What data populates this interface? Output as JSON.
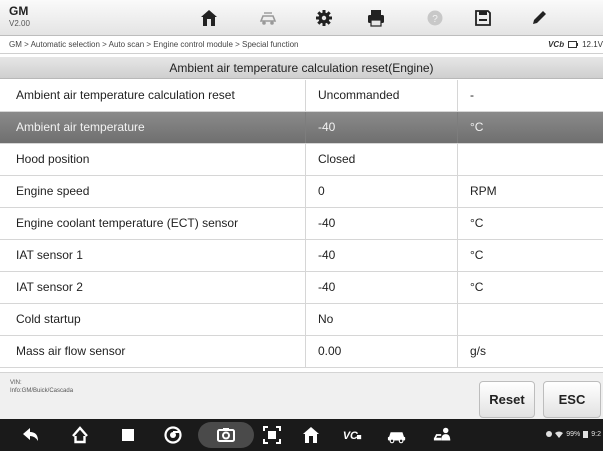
{
  "app": {
    "make": "GM",
    "version": "V2.00"
  },
  "toolbar": {
    "icons": [
      "home-icon",
      "vehicle-swap-icon",
      "settings-gear-icon",
      "print-icon",
      "help-icon",
      "save-icon",
      "edit-icon"
    ]
  },
  "breadcrumb": {
    "text": "GM > Automatic selection > Auto scan > Engine control module > Special function"
  },
  "vci": {
    "label": "VCb",
    "voltage": "12.1V"
  },
  "page": {
    "title": "Ambient air temperature calculation reset(Engine)"
  },
  "table": {
    "rows": [
      {
        "name": "Ambient air temperature calculation reset",
        "value": "Uncommanded",
        "unit": "-"
      },
      {
        "name": "Ambient air temperature",
        "value": "-40",
        "unit": "°C",
        "selected": true
      },
      {
        "name": "Hood position",
        "value": "Closed",
        "unit": ""
      },
      {
        "name": "Engine speed",
        "value": "0",
        "unit": "RPM"
      },
      {
        "name": "Engine coolant temperature (ECT) sensor",
        "value": "-40",
        "unit": "°C"
      },
      {
        "name": "IAT sensor 1",
        "value": "-40",
        "unit": "°C"
      },
      {
        "name": "IAT sensor 2",
        "value": "-40",
        "unit": "°C"
      },
      {
        "name": "Cold startup",
        "value": "No",
        "unit": ""
      },
      {
        "name": "Mass air flow sensor",
        "value": "0.00",
        "unit": "g/s"
      }
    ]
  },
  "footer": {
    "vin_label": "VIN:",
    "info": "Info:GM/Buick/Cascada",
    "reset_label": "Reset",
    "esc_label": "ESC"
  },
  "navbar": {
    "icons": [
      "back-icon",
      "home-icon",
      "recents-icon",
      "chrome-icon",
      "camera-icon",
      "screenshot-icon",
      "home-shop-icon",
      "vci-icon",
      "car-icon",
      "technician-icon"
    ],
    "battery": "99%",
    "time": "9:2"
  },
  "colors": {
    "selected_row": "#777777",
    "navbar_bg": "#1a1a1a"
  }
}
